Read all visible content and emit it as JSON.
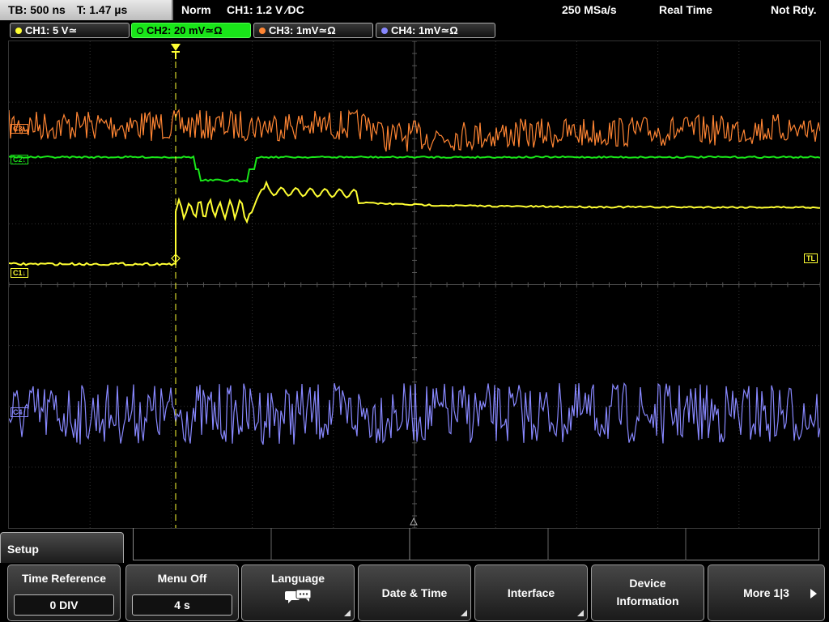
{
  "status": {
    "timebase": "TB: 500 ns",
    "trigger_time": "T: 1.47 µs",
    "mode": "Norm",
    "trigger_info": "CH1: 1.2 V ∕DC",
    "sample_rate": "250 MSa/s",
    "acq_mode": "Real Time",
    "state": "Not Rdy."
  },
  "channels": [
    {
      "label": "CH1: 5 V≃",
      "color": "#ffff33"
    },
    {
      "label": "CH2: 20 mV≃Ω",
      "color": "#19e619"
    },
    {
      "label": "CH3: 1mV≃Ω",
      "color": "#ff8533"
    },
    {
      "label": "CH4: 1mV≃Ω",
      "color": "#8888ff"
    }
  ],
  "markers": {
    "c1": "C1↓",
    "c2": "C2↓",
    "c3": "C3↓",
    "c4": "C4↓",
    "tl": "TL"
  },
  "menu": {
    "title": "Setup",
    "softkeys": [
      {
        "label": "Time Reference",
        "value": "0 DIV"
      },
      {
        "label": "Menu Off",
        "value": "4 s"
      },
      {
        "label": "Language",
        "icon": "speech-bubbles-icon"
      },
      {
        "label": "Date & Time"
      },
      {
        "label": "Interface"
      },
      {
        "label": "Device",
        "label2": "Information"
      },
      {
        "label": "More 1|3",
        "icon": "arrow-right-icon"
      }
    ]
  }
}
